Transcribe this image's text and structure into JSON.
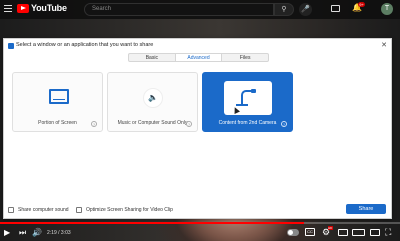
{
  "youtube": {
    "logo_text": "YouTube",
    "search_placeholder": "Search",
    "notification_count": "9+",
    "avatar_letter": "T"
  },
  "player": {
    "time_display": "2:19 / 3:03",
    "progress_fraction": 0.76,
    "cc_label": "CC",
    "hd_badge": "HD"
  },
  "dialog": {
    "title": "Select a window or an application that you want to share",
    "tabs": [
      {
        "label": "Basic",
        "active": false
      },
      {
        "label": "Advanced",
        "active": true
      },
      {
        "label": "Files",
        "active": false
      }
    ],
    "options": [
      {
        "label": "Portion of Screen",
        "icon": "screen-portion-icon",
        "selected": false
      },
      {
        "label": "Music or Computer Sound Only",
        "icon": "speaker-icon",
        "selected": false
      },
      {
        "label": "Content from 2nd Camera",
        "icon": "document-camera-icon",
        "selected": true
      }
    ],
    "share_computer_sound": {
      "label": "Share computer sound",
      "checked": false
    },
    "optimize_video": {
      "label": "Optimize Screen Sharing for Video Clip",
      "checked": false
    },
    "share_button": "Share"
  },
  "colors": {
    "accent": "#1b6ac9",
    "youtube_red": "#ff0000"
  }
}
